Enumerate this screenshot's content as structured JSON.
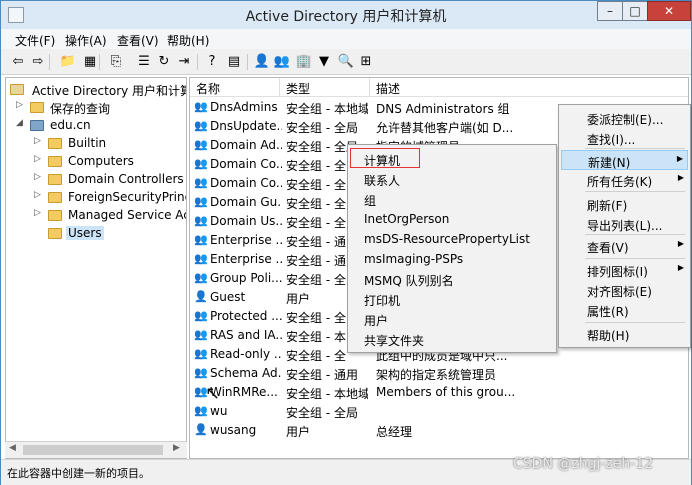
{
  "window": {
    "title": "Active Directory 用户和计算机",
    "min_glyph": "–",
    "max_glyph": "□",
    "close_glyph": "✕"
  },
  "menubar": [
    "文件(F)",
    "操作(A)",
    "查看(V)",
    "帮助(H)"
  ],
  "toolbar_icons": [
    "back-arrow-icon",
    "forward-arrow-icon",
    "folder-up-icon",
    "show-tree-icon",
    "copy-icon",
    "properties-icon",
    "refresh-icon",
    "export-icon",
    "help-icon",
    "view-icon",
    "new-user-icon",
    "new-group-icon",
    "new-ou-icon",
    "filter-icon",
    "find-icon",
    "add-to-group-icon"
  ],
  "toolbar_glyphs": [
    "⇦",
    "⇨",
    "📁",
    "▦",
    "⎘",
    "☰",
    "↻",
    "⇥",
    "?",
    "▤",
    "👤",
    "👥",
    "🏢",
    "▼",
    "🔍",
    "⊞"
  ],
  "tree": {
    "root": "Active Directory 用户和计算机",
    "saved_queries": "保存的查询",
    "domain": "edu.cn",
    "children": [
      "Builtin",
      "Computers",
      "Domain Controllers",
      "ForeignSecurityPrincipa",
      "Managed Service Acco",
      "Users"
    ]
  },
  "columns": [
    "名称",
    "类型",
    "描述"
  ],
  "rows": [
    {
      "name": "DnsAdmins",
      "type": "安全组 - 本地域",
      "desc": "DNS Administrators 组"
    },
    {
      "name": "DnsUpdate...",
      "type": "安全组 - 全局",
      "desc": "允许替其他客户端(如 D..."
    },
    {
      "name": "Domain Ad...",
      "type": "安全组 - 全局",
      "desc": "指定的域管理员"
    },
    {
      "name": "Domain Co...",
      "type": "安全组 - 全",
      "desc": ""
    },
    {
      "name": "Domain Co...",
      "type": "安全组 - 全",
      "desc": ""
    },
    {
      "name": "Domain Gu...",
      "type": "安全组 - 全",
      "desc": ""
    },
    {
      "name": "Domain Us...",
      "type": "安全组 - 全",
      "desc": ""
    },
    {
      "name": "Enterprise ...",
      "type": "安全组 - 通",
      "desc": ""
    },
    {
      "name": "Enterprise ...",
      "type": "安全组 - 通",
      "desc": ""
    },
    {
      "name": "Group Poli...",
      "type": "安全组 - 全",
      "desc": ""
    },
    {
      "name": "Guest",
      "type": "用户",
      "desc": ""
    },
    {
      "name": "Protected ...",
      "type": "安全组 - 全",
      "desc": ""
    },
    {
      "name": "RAS and IA...",
      "type": "安全组 - 本",
      "desc": ""
    },
    {
      "name": "Read-only ...",
      "type": "安全组 - 全",
      "desc": "此组中的成员是域中只..."
    },
    {
      "name": "Schema Ad...",
      "type": "安全组 - 通用",
      "desc": "架构的指定系统管理员"
    },
    {
      "name": "WinRMRe...",
      "type": "安全组 - 本地域",
      "desc": "Members of this grou..."
    },
    {
      "name": "wu",
      "type": "安全组 - 全局",
      "desc": ""
    },
    {
      "name": "wusang",
      "type": "用户",
      "desc": "总经理"
    }
  ],
  "context_menu": {
    "items": [
      "委派控制(E)...",
      "查找(I)...",
      "新建(N)",
      "所有任务(K)",
      "刷新(F)",
      "导出列表(L)...",
      "查看(V)",
      "排列图标(I)",
      "对齐图标(E)",
      "属性(R)",
      "帮助(H)"
    ]
  },
  "new_submenu": {
    "items": [
      "计算机",
      "联系人",
      "组",
      "InetOrgPerson",
      "msDS-ResourcePropertyList",
      "msImaging-PSPs",
      "MSMQ 队列别名",
      "打印机",
      "用户",
      "共享文件夹"
    ]
  },
  "status_text": "在此容器中创建一新的项目。",
  "watermark": "CSDN @zhgj-zeh-12"
}
